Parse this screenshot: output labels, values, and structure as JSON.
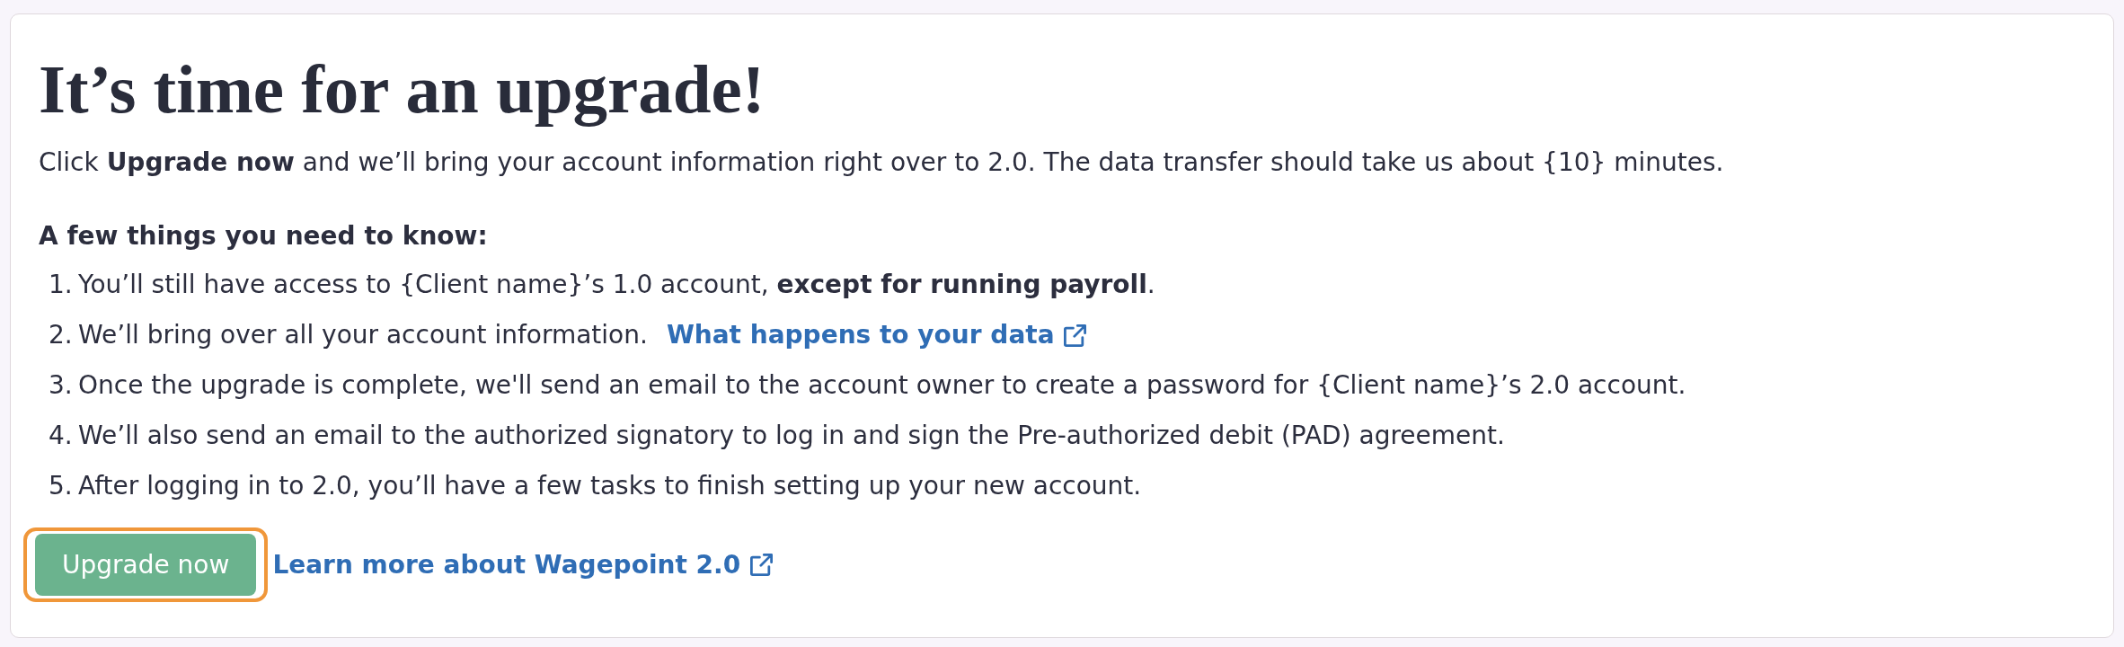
{
  "card": {
    "title": "It’s time for an upgrade!",
    "intro": "Click **Upgrade now** and we’ll bring your account information right over to 2.0. The data transfer should take us about {10} minutes.",
    "list_heading": "A few things you need to know:",
    "items": [
      {
        "number": "1.",
        "text": "You’ll still have access to {Client name}’s 1.0 account, **except for running payroll**."
      },
      {
        "number": "2.",
        "text": "We’ll bring over all your account information.",
        "link": "What happens to your data"
      },
      {
        "number": "3.",
        "text": "Once the upgrade is complete, we'll send an email to the account owner to create a password for {Client name}’s 2.0 account."
      },
      {
        "number": "4.",
        "text": "We’ll also send an email to the authorized signatory to log in and sign the Pre-authorized debit (PAD) agreement."
      },
      {
        "number": "5.",
        "text": "After logging in to 2.0, you’ll have a few tasks to finish setting up your new account."
      }
    ],
    "actions": {
      "button": {
        "label": "Upgrade now",
        "focused": true
      },
      "link": "Learn more about Wagepoint 2.0"
    }
  }
}
